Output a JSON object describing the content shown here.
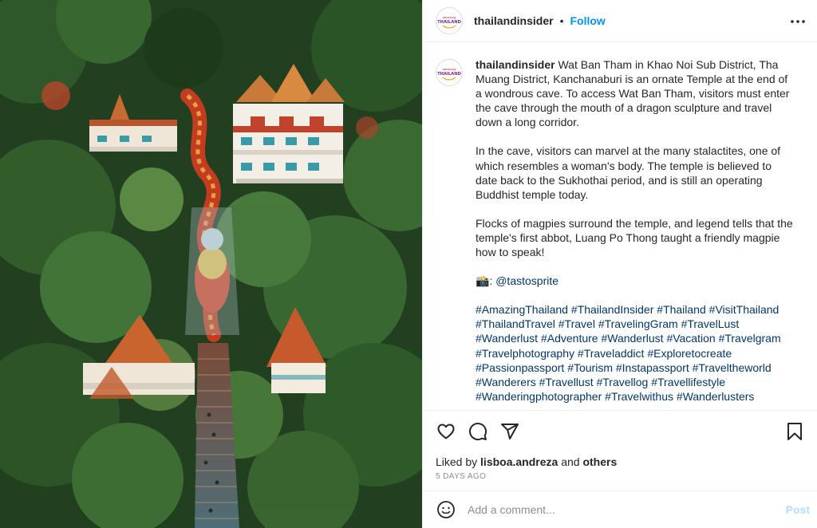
{
  "post": {
    "username": "thailandinsider",
    "separator": "•",
    "follow_label": "Follow",
    "more_icon": "more-horizontal-icon",
    "avatar_logo": {
      "line1": "amazing",
      "line2": "THAILAND"
    }
  },
  "caption": {
    "username": "thailandinsider",
    "paragraphs": [
      "Wat Ban Tham in Khao Noi Sub District, Tha Muang District, Kanchanaburi is an ornate Temple at the end of a wondrous cave. To access Wat Ban Tham, visitors must enter the cave through the mouth of a dragon sculpture and travel down a long corridor.",
      "In the cave, visitors can marvel at the many stalactites, one of which resembles a woman's body. The temple is believed to date back to the Sukhothai period, and is still an operating Buddhist temple today.",
      "Flocks of magpies surround the temple, and legend tells that the temple's first abbot, Luang Po Thong taught a friendly magpie how to speak!"
    ],
    "credit_emoji": "📸",
    "credit_sep": ": ",
    "credit_handle": "@tastosprite",
    "hashtags": [
      "#AmazingThailand",
      "#ThailandInsider",
      "#Thailand",
      "#VisitThailand",
      "#ThailandTravel",
      "#Travel",
      "#TravelingGram",
      "#TravelLust",
      "#Wanderlust",
      "#Adventure",
      "#Wanderlust",
      "#Vacation",
      "#Travelgram",
      "#Travelphotography",
      "#Traveladdict",
      "#Exploretocreate",
      "#Passionpassport",
      "#Tourism",
      "#Instapassport",
      "#Traveltheworld",
      "#Wanderers",
      "#Travellust",
      "#Travellog",
      "#Travellifestyle",
      "#Wanderingphotographer",
      "#Travelwithus",
      "#Wanderlusters"
    ]
  },
  "actions": {
    "icons": [
      "heart-icon",
      "comment-icon",
      "share-icon",
      "bookmark-icon"
    ]
  },
  "likes": {
    "prefix": "Liked by",
    "user": "lisboa.andreza",
    "and": "and",
    "others": "others"
  },
  "timestamp": "5 DAYS AGO",
  "comment": {
    "placeholder": "Add a comment...",
    "post_label": "Post",
    "emoji_icon": "emoji-smile-icon"
  },
  "colors": {
    "accent": "#0095f6",
    "hashtag": "#00376b",
    "post_disabled": "#b2dffc",
    "muted": "#8e8e8e",
    "text": "#262626"
  }
}
